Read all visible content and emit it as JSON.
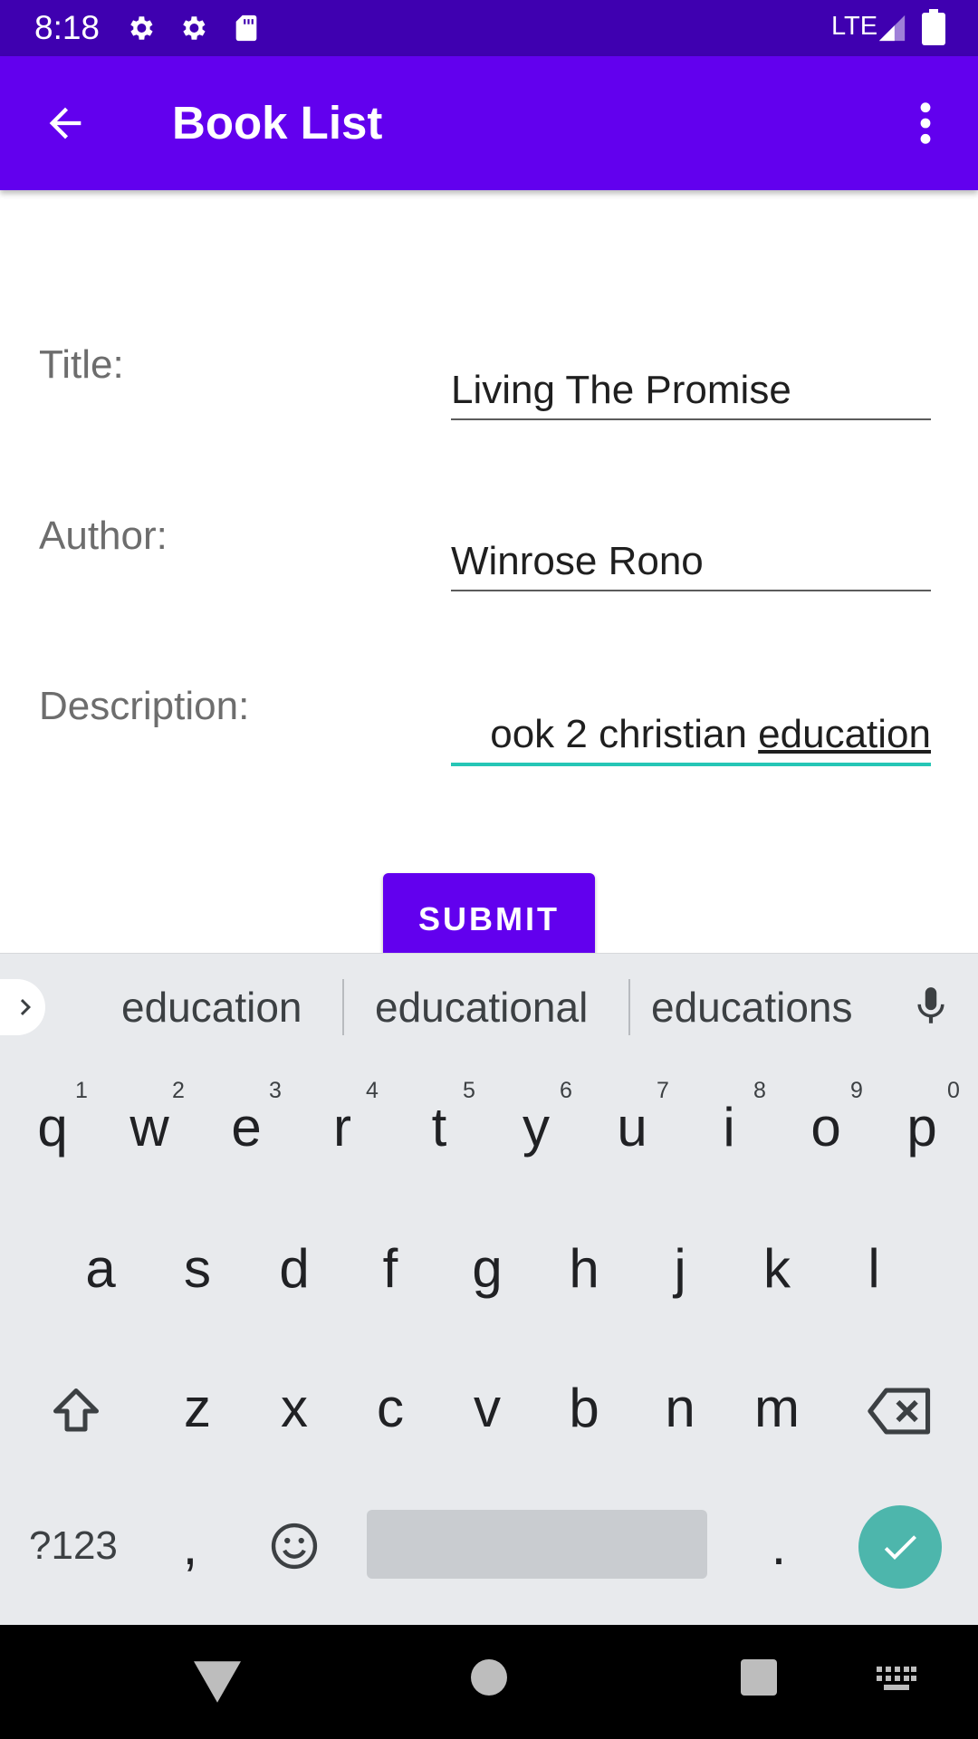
{
  "status_bar": {
    "time": "8:18",
    "network": "LTE",
    "icons": [
      "settings-icon",
      "settings-icon",
      "sd-card-icon",
      "signal-icon",
      "battery-icon"
    ]
  },
  "app_bar": {
    "title": "Book List",
    "icons": [
      "back-arrow-icon",
      "more-vert-icon"
    ]
  },
  "form": {
    "title_label": "Title:",
    "title_value": "Living The Promise",
    "author_label": "Author:",
    "author_value": "Winrose Rono",
    "description_label": "Description:",
    "description_value_prefix": "ook  2 christian ",
    "description_value_word": "education",
    "submit_label": "SUBMIT"
  },
  "keyboard": {
    "suggestions": [
      "education",
      "educational",
      "educations"
    ],
    "row1": [
      "q",
      "w",
      "e",
      "r",
      "t",
      "y",
      "u",
      "i",
      "o",
      "p"
    ],
    "row1_hints": [
      "1",
      "2",
      "3",
      "4",
      "5",
      "6",
      "7",
      "8",
      "9",
      "0"
    ],
    "row2": [
      "a",
      "s",
      "d",
      "f",
      "g",
      "h",
      "j",
      "k",
      "l"
    ],
    "row3": [
      "z",
      "x",
      "c",
      "v",
      "b",
      "n",
      "m"
    ],
    "symbols_label": "?123",
    "comma": ",",
    "period": "."
  },
  "colors": {
    "status_bar": "#3f00b0",
    "app_bar": "#6200ee",
    "accent": "#26c6b6",
    "keyboard_bg": "#e8eaed",
    "done_key": "#4db6ac"
  }
}
